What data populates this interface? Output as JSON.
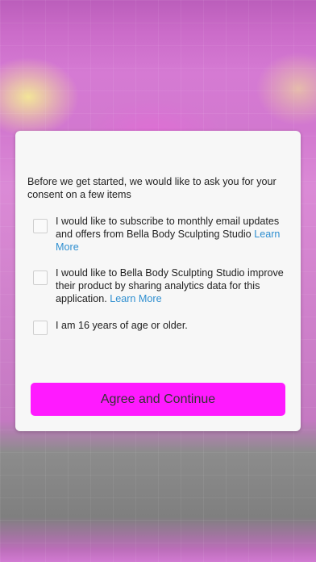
{
  "consent": {
    "intro": "Before we get started, we would like to ask you for your consent on a few items",
    "options": [
      {
        "text": "I would like to subscribe to monthly email updates and offers from Bella Body Sculpting Studio",
        "link": "Learn More",
        "checked": false
      },
      {
        "text": "I would like to Bella Body Sculpting Studio improve their product by sharing analytics data for this application.",
        "link": "Learn More",
        "checked": false
      },
      {
        "text": "I am 16 years of age or older.",
        "link": "",
        "checked": false
      }
    ],
    "button_label": "Agree and Continue"
  },
  "colors": {
    "accent": "#ff1aff",
    "link": "#2f8fd0",
    "dialog_bg": "#f7f7f7"
  }
}
